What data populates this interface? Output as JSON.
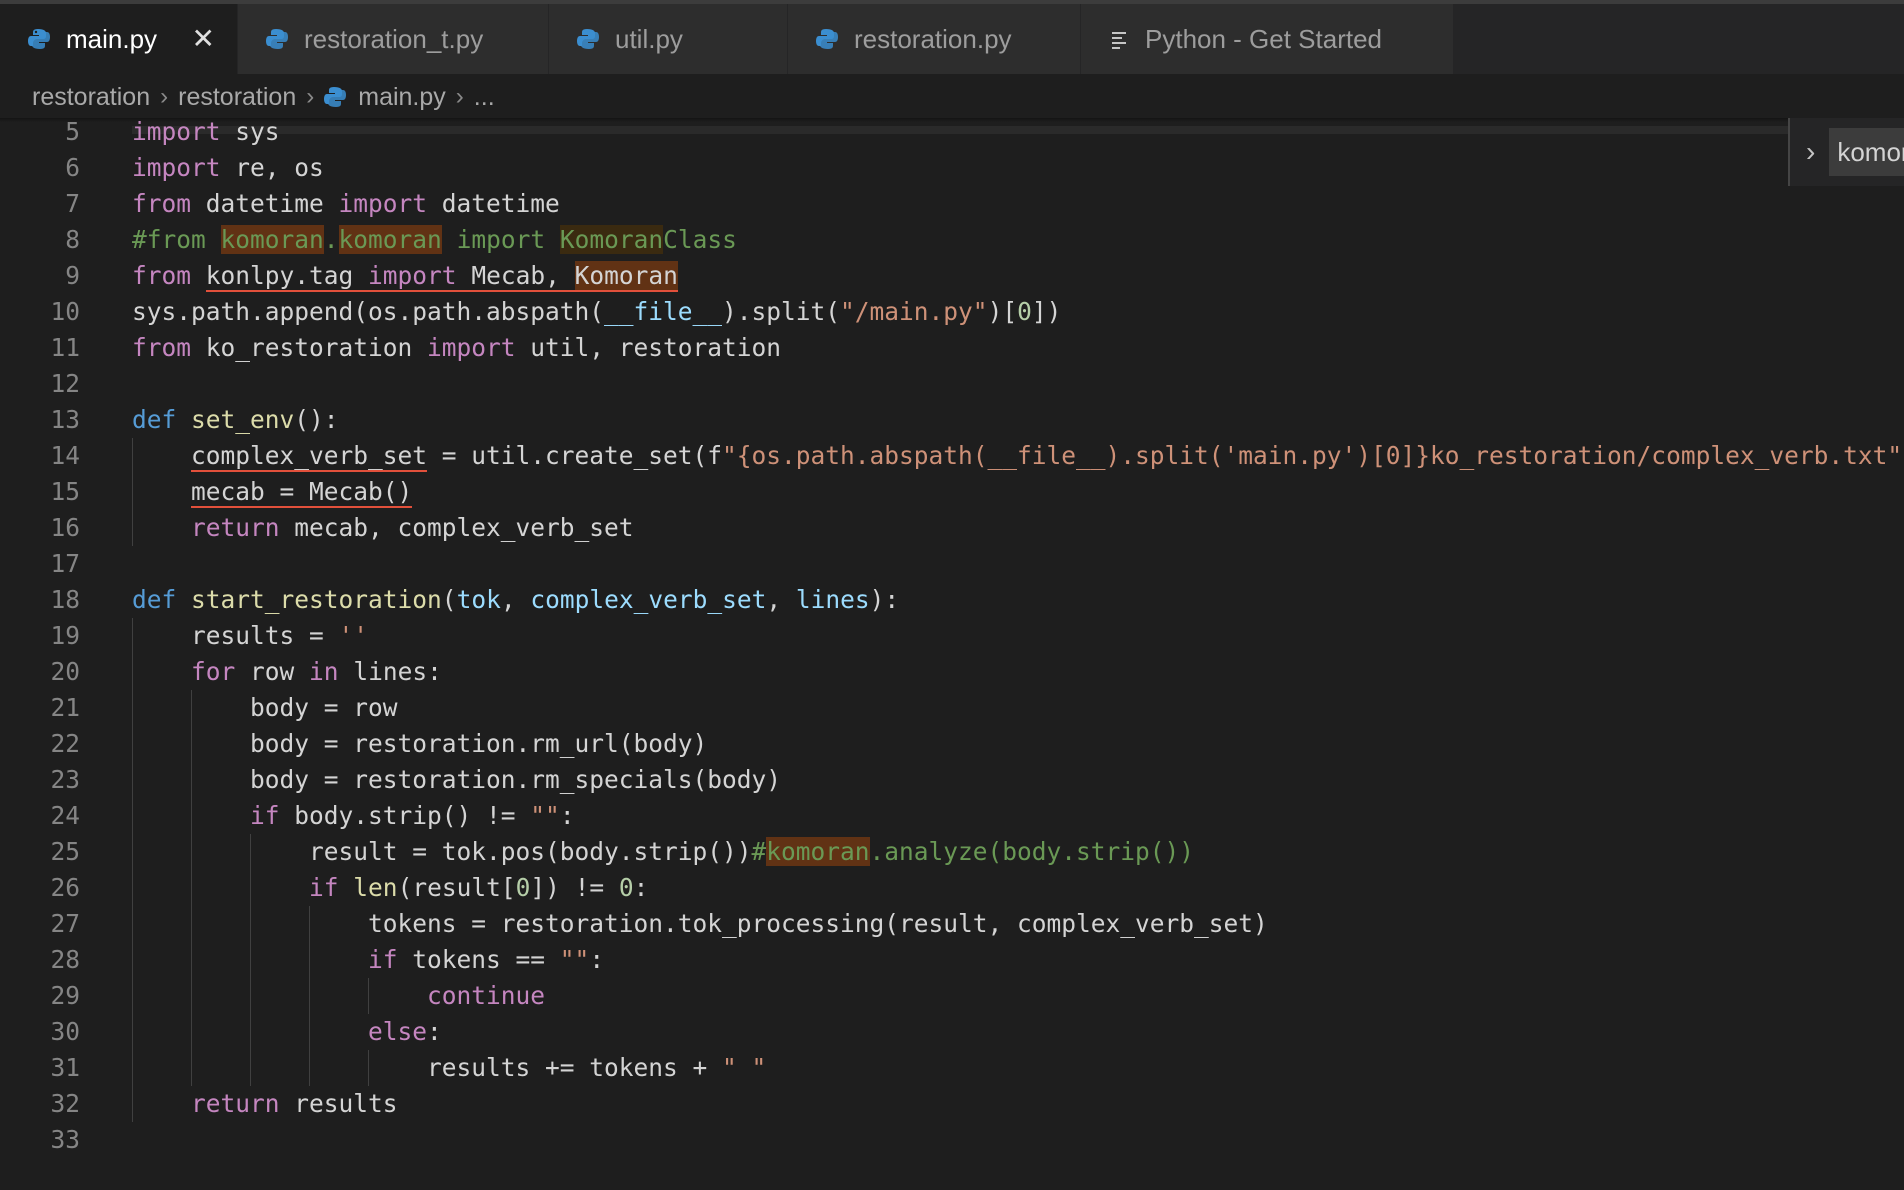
{
  "tabs": [
    {
      "label": "main.py",
      "icon": "python-icon",
      "active": true
    },
    {
      "label": "restoration_t.py",
      "icon": "python-icon"
    },
    {
      "label": "util.py",
      "icon": "python-icon"
    },
    {
      "label": "restoration.py",
      "icon": "python-icon"
    },
    {
      "label": "Python - Get Started",
      "icon": "document-icon"
    }
  ],
  "breadcrumb": {
    "folder1": "restoration",
    "folder2": "restoration",
    "file": "main.py",
    "more": "..."
  },
  "find_widget": {
    "query": "komoran"
  },
  "lines": [
    {
      "n": "5",
      "t": "import sys"
    },
    {
      "n": "6",
      "t": "import re, os"
    },
    {
      "n": "7",
      "t": "from datetime import datetime"
    },
    {
      "n": "8",
      "t": "#from komoran.komoran import KomoranClass"
    },
    {
      "n": "9",
      "t": "from konlpy.tag import Mecab, Komoran"
    },
    {
      "n": "10",
      "t": "sys.path.append(os.path.abspath(__file__).split(\"/main.py\")[0])"
    },
    {
      "n": "11",
      "t": "from ko_restoration import util, restoration"
    },
    {
      "n": "12",
      "t": ""
    },
    {
      "n": "13",
      "t": "def set_env():"
    },
    {
      "n": "14",
      "t": "    complex_verb_set = util.create_set(f\"{os.path.abspath(__file__).split('main.py')[0]}ko_restoration/complex_verb.txt\")"
    },
    {
      "n": "15",
      "t": "    mecab = Mecab()"
    },
    {
      "n": "16",
      "t": "    return mecab, complex_verb_set"
    },
    {
      "n": "17",
      "t": ""
    },
    {
      "n": "18",
      "t": "def start_restoration(tok, complex_verb_set, lines):"
    },
    {
      "n": "19",
      "t": "    results = ''"
    },
    {
      "n": "20",
      "t": "    for row in lines:"
    },
    {
      "n": "21",
      "t": "        body = row"
    },
    {
      "n": "22",
      "t": "        body = restoration.rm_url(body)"
    },
    {
      "n": "23",
      "t": "        body = restoration.rm_specials(body)"
    },
    {
      "n": "24",
      "t": "        if body.strip() != \"\":"
    },
    {
      "n": "25",
      "t": "            result = tok.pos(body.strip())#komoran.analyze(body.strip())"
    },
    {
      "n": "26",
      "t": "            if len(result[0]) != 0:"
    },
    {
      "n": "27",
      "t": "                tokens = restoration.tok_processing(result, complex_verb_set)"
    },
    {
      "n": "28",
      "t": "                if tokens == \"\":"
    },
    {
      "n": "29",
      "t": "                    continue"
    },
    {
      "n": "30",
      "t": "                else:"
    },
    {
      "n": "31",
      "t": "                    results += tokens + \" \""
    },
    {
      "n": "32",
      "t": "    return results"
    },
    {
      "n": "33",
      "t": ""
    }
  ]
}
